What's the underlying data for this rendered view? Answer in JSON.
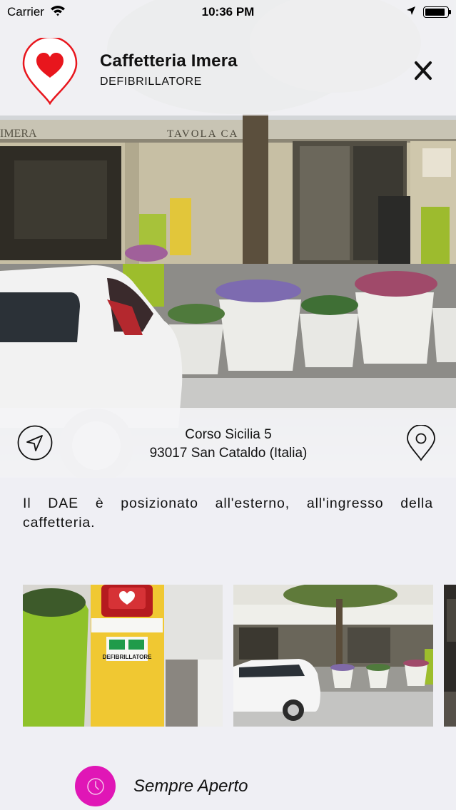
{
  "status_bar": {
    "carrier": "Carrier",
    "time": "10:36 PM",
    "battery_level": 0.9,
    "icons": [
      "wifi-icon",
      "location-arrow-icon",
      "battery-icon"
    ]
  },
  "header": {
    "title": "Caffetteria Imera",
    "subtitle": "DEFIBRILLATORE",
    "pin_icon": "heart-pin-icon",
    "close_icon": "close-icon",
    "brand_color": "#e8161d"
  },
  "hero": {
    "shop_sign": "TAVOLA CA",
    "left_sign": "IMERA"
  },
  "address": {
    "line1": "Corso Sicilia 5",
    "line2": "93017 San Cataldo (Italia)",
    "navigate_icon": "navigation-arrow-icon",
    "map_icon": "map-pin-icon"
  },
  "description": "Il DAE è posizionato all'esterno, all'ingresso della caffetteria.",
  "gallery": {
    "photos": [
      "defibrillator-cabinet-photo",
      "cafe-storefront-photo",
      "additional-photo"
    ],
    "cabinet_label": "DEFIBRILLATORE"
  },
  "hours": {
    "label": "Sempre Aperto",
    "icon": "clock-icon",
    "accent_color": "#e016b6"
  }
}
